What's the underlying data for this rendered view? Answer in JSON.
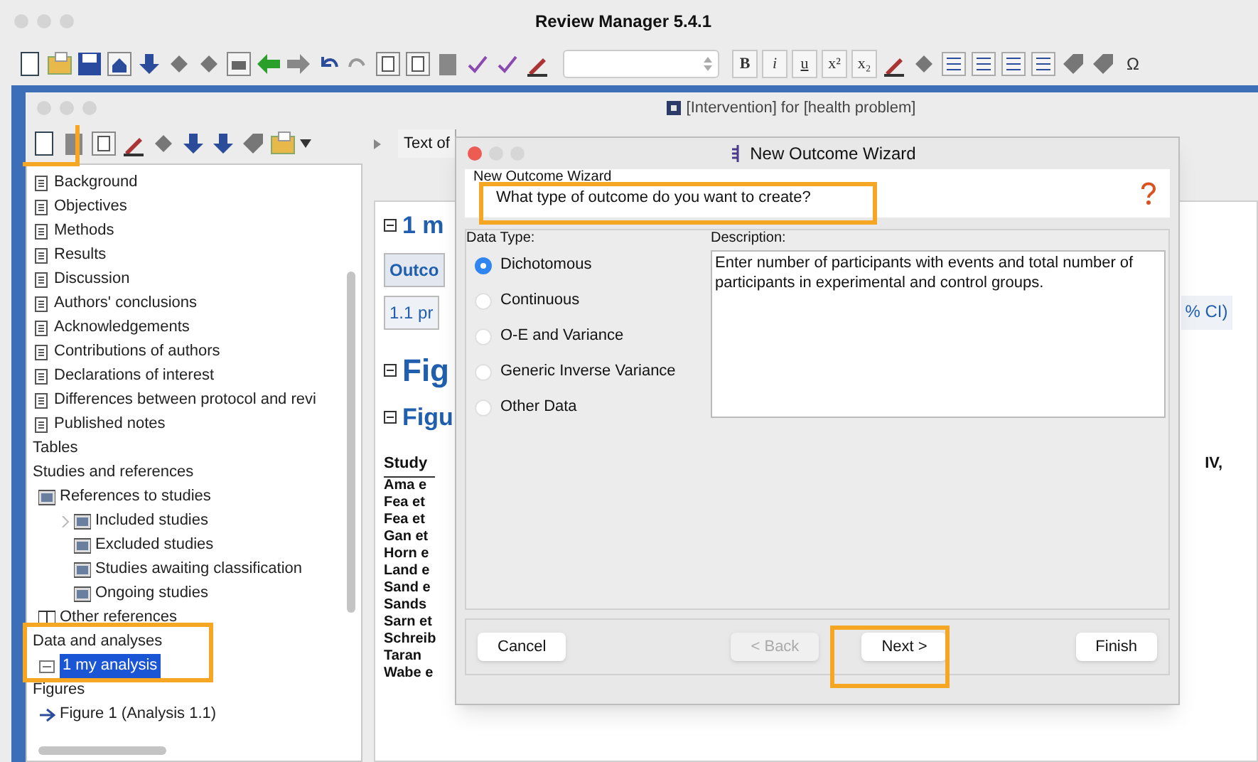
{
  "app_window": {
    "title": "Review Manager 5.4.1"
  },
  "toolbar": {
    "format_buttons": [
      "B",
      "i",
      "u",
      "x²",
      "x₂"
    ],
    "symbol_button": "Ω"
  },
  "review_window": {
    "title": "[Intervention] for [health problem]"
  },
  "tree": [
    {
      "label": "Background",
      "kind": "section",
      "selected": false
    },
    {
      "label": "Objectives",
      "kind": "section",
      "selected": false
    },
    {
      "label": "Methods",
      "kind": "section",
      "selected": false
    },
    {
      "label": "Results",
      "kind": "section",
      "selected": false
    },
    {
      "label": "Discussion",
      "kind": "section",
      "selected": false
    },
    {
      "label": "Authors' conclusions",
      "kind": "section",
      "selected": false
    },
    {
      "label": "Acknowledgements",
      "kind": "section",
      "selected": false
    },
    {
      "label": "Contributions of authors",
      "kind": "section",
      "selected": false
    },
    {
      "label": "Declarations of interest",
      "kind": "section",
      "selected": false
    },
    {
      "label": "Differences between protocol and revi",
      "kind": "section",
      "selected": false
    },
    {
      "label": "Published notes",
      "kind": "section",
      "selected": false
    },
    {
      "label": "Tables",
      "kind": "heading",
      "selected": false
    },
    {
      "label": "Studies and references",
      "kind": "heading",
      "selected": false,
      "children": [
        {
          "label": "References to studies",
          "kind": "reference",
          "selected": false,
          "children": [
            {
              "label": "Included studies",
              "kind": "reference",
              "selected": false,
              "expandable": true
            },
            {
              "label": "Excluded studies",
              "kind": "reference",
              "selected": false
            },
            {
              "label": "Studies awaiting classification",
              "kind": "reference",
              "selected": false
            },
            {
              "label": "Ongoing studies",
              "kind": "reference",
              "selected": false
            }
          ]
        },
        {
          "label": "Other references",
          "kind": "book",
          "selected": false
        }
      ]
    },
    {
      "label": "Data and analyses",
      "kind": "heading",
      "selected": false,
      "children": [
        {
          "label": "1 my analysis",
          "kind": "analysis",
          "selected": true
        }
      ]
    },
    {
      "label": "Figures",
      "kind": "heading",
      "selected": false,
      "children": [
        {
          "label": "Figure 1 (Analysis 1.1)",
          "kind": "figure",
          "selected": false
        }
      ]
    }
  ],
  "content": {
    "tab": "Text of",
    "heading": "1 m",
    "outcome_header": "Outco",
    "outcome_row": "1.1 pr",
    "outcome_row_end": "% CI)",
    "figures_heading": "Fig",
    "figure_heading": "Figu",
    "study_column": "Study",
    "study_column_end": "IV,",
    "studies": [
      "Ama e",
      "Fea et",
      "Fea et",
      "Gan et",
      "Horn e",
      "Land e",
      "Sand e",
      "Sands",
      "Sarn et",
      "Schreib",
      "Taran",
      "Wabe e"
    ]
  },
  "dialog": {
    "title": "New Outcome Wizard",
    "header": "New Outcome Wizard",
    "question": "What type of outcome do you want to create?",
    "data_type_label": "Data Type:",
    "description_label": "Description:",
    "data_types": [
      {
        "label": "Dichotomous",
        "selected": true
      },
      {
        "label": "Continuous",
        "selected": false
      },
      {
        "label": "O-E and Variance",
        "selected": false
      },
      {
        "label": "Generic Inverse Variance",
        "selected": false
      },
      {
        "label": "Other Data",
        "selected": false
      }
    ],
    "description": "Enter number of participants with events and total number of participants in experimental and control groups.",
    "buttons": [
      {
        "label": "Cancel",
        "disabled": false
      },
      {
        "label": "< Back",
        "disabled": true
      },
      {
        "label": "Next >",
        "disabled": false
      },
      {
        "label": "Finish",
        "disabled": false
      }
    ]
  }
}
